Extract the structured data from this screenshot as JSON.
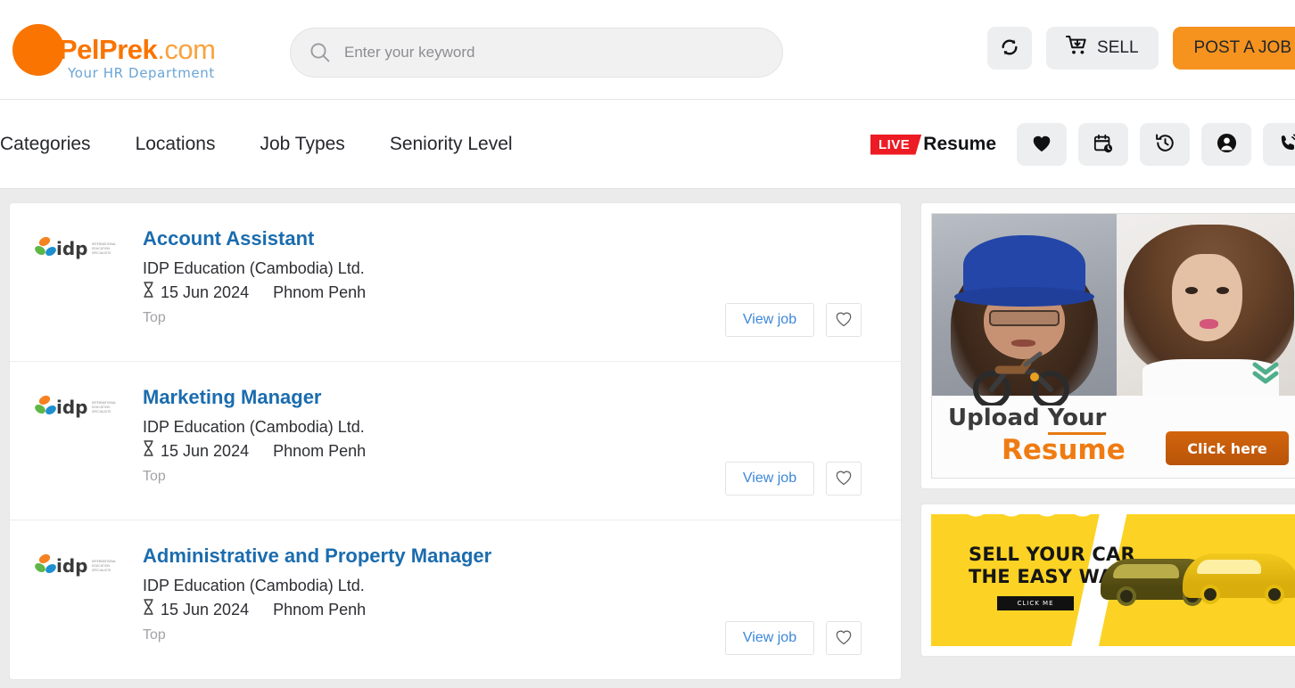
{
  "header": {
    "logo": {
      "name_main": "PelPrek",
      "name_tld": ".com",
      "tagline": "Your HR Department"
    },
    "search": {
      "placeholder": "Enter your keyword",
      "value": "",
      "icon": "search-icon"
    },
    "refresh_button": {
      "icon": "refresh-icon",
      "label": ""
    },
    "sell_button": {
      "label": "SELL",
      "icon": "shopping-cart-download-icon"
    },
    "post_job_button": {
      "label": "POST A JOB"
    }
  },
  "nav": {
    "links": [
      {
        "label": "Categories"
      },
      {
        "label": "Locations"
      },
      {
        "label": "Job Types"
      },
      {
        "label": "Seniority Level"
      }
    ],
    "live_badge": "LIVE",
    "live_label": "Resume",
    "icons": [
      {
        "name": "heart-icon",
        "title": "Favorites"
      },
      {
        "name": "calendar-clock-icon",
        "title": "Schedule"
      },
      {
        "name": "history-clock-icon",
        "title": "History"
      },
      {
        "name": "user-account-icon",
        "title": "Account"
      },
      {
        "name": "phone-ring-icon",
        "title": "Contact"
      }
    ]
  },
  "jobs": [
    {
      "logo_alt": "idp",
      "logo_sub": "INTERNATIONAL EDUCATION SPECIALISTS",
      "title": "Account Assistant",
      "company": "IDP Education (Cambodia) Ltd.",
      "date": "15 Jun 2024",
      "location": "Phnom Penh",
      "tag": "Top",
      "view_label": "View job"
    },
    {
      "logo_alt": "idp",
      "logo_sub": "INTERNATIONAL EDUCATION SPECIALISTS",
      "title": "Marketing Manager",
      "company": "IDP Education (Cambodia) Ltd.",
      "date": "15 Jun 2024",
      "location": "Phnom Penh",
      "tag": "Top",
      "view_label": "View job"
    },
    {
      "logo_alt": "idp",
      "logo_sub": "INTERNATIONAL EDUCATION SPECIALISTS",
      "title": "Administrative and Property Manager",
      "company": "IDP Education (Cambodia) Ltd.",
      "date": "15 Jun 2024",
      "location": "Phnom Penh",
      "tag": "Top",
      "view_label": "View job"
    }
  ],
  "sidebar": {
    "resume_ad": {
      "line1_a": "Upload ",
      "line1_b": "Your",
      "line2": "Resume",
      "cta": "Click here"
    },
    "car_ad": {
      "line1": "SELL YOUR CAR",
      "line2": "THE EASY WAY",
      "cta": "CLICK ME"
    },
    "scroll_indicator": "double-chevron-down-icon"
  },
  "colors": {
    "brand_orange": "#f97400",
    "post_job_orange": "#f5931e",
    "link_blue": "#1b6cae",
    "live_red": "#ed1b24",
    "car_yellow": "#fcd324",
    "chevron_green": "#4fae8b"
  }
}
